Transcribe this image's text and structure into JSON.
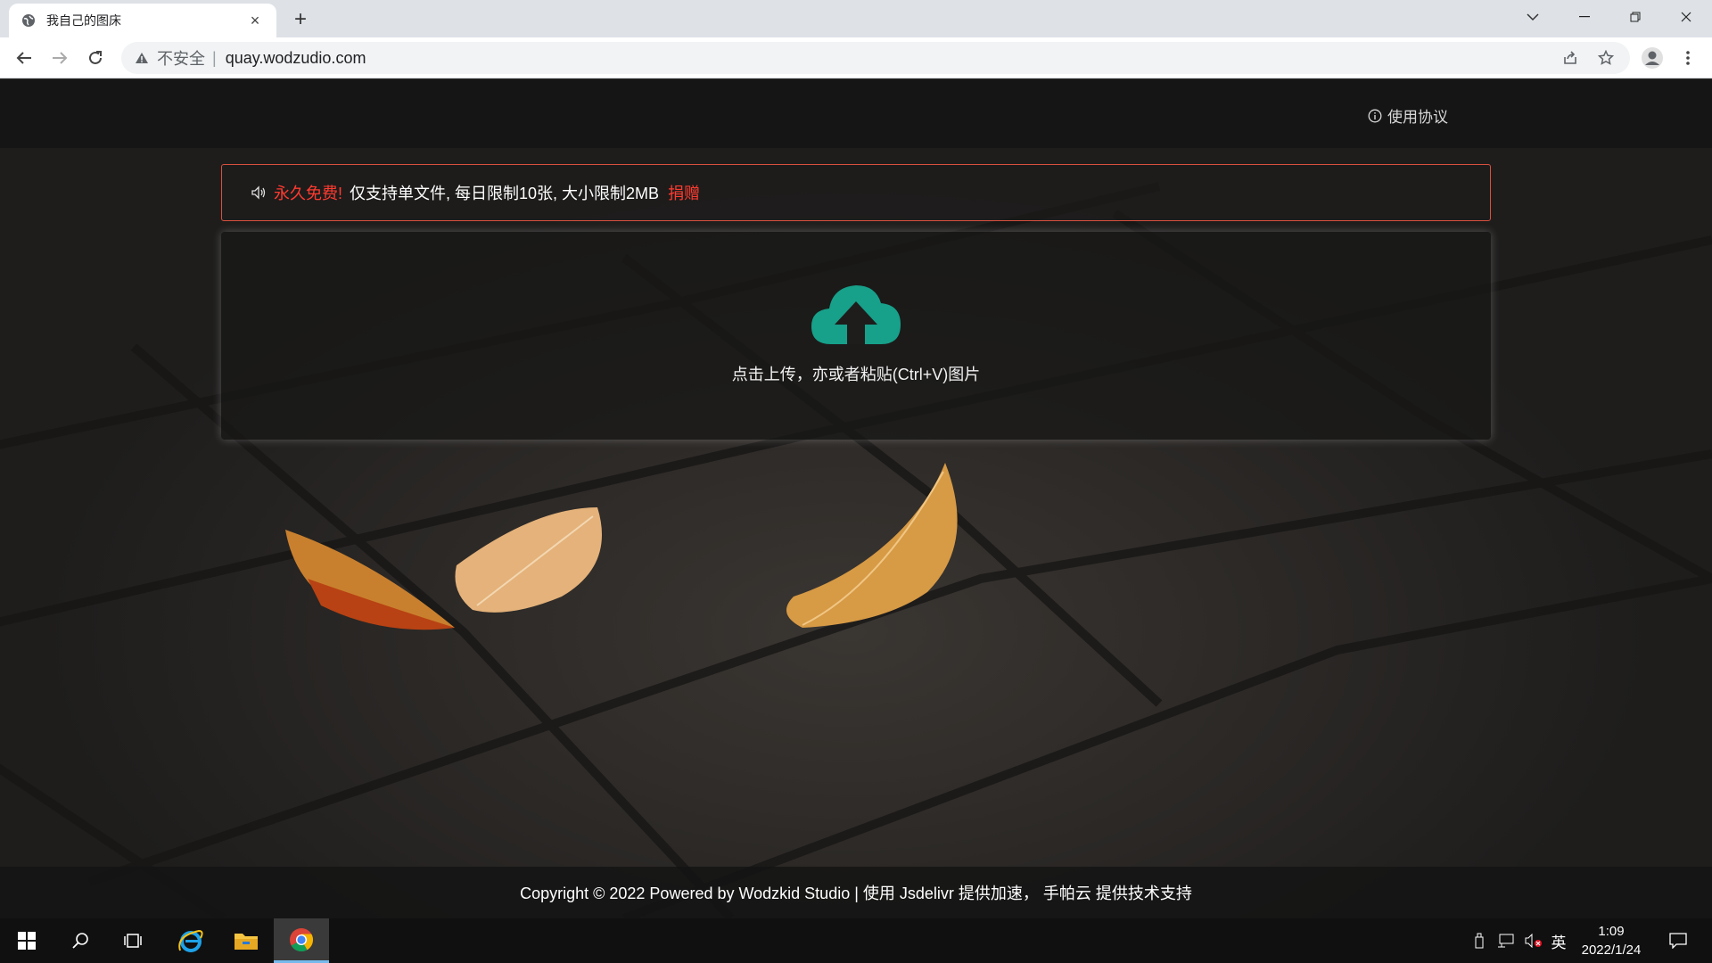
{
  "browser": {
    "tab_title": "我自己的图床",
    "tab_close": "×",
    "new_tab": "+",
    "security_label": "不安全",
    "address_separator": "|",
    "url": "quay.wodzudio.com"
  },
  "page": {
    "nav": {
      "agreement_label": "使用协议"
    },
    "notice": {
      "free_label": "永久免费!",
      "message": "仅支持单文件, 每日限制10张, 大小限制2MB",
      "donate_label": "捐赠"
    },
    "upload": {
      "hint": "点击上传，亦或者粘贴(Ctrl+V)图片"
    },
    "footer": {
      "text": "Copyright © 2022 Powered by Wodzkid Studio | 使用 Jsdelivr 提供加速， 手帕云 提供技术支持"
    }
  },
  "taskbar": {
    "ime_label": "英",
    "time": "1:09",
    "date": "2022/1/24"
  },
  "colors": {
    "accent_red": "#ff3b30",
    "notice_border": "#d9503f",
    "cloud_teal": "#17a08a",
    "taskbar_active": "#76b9ed"
  }
}
